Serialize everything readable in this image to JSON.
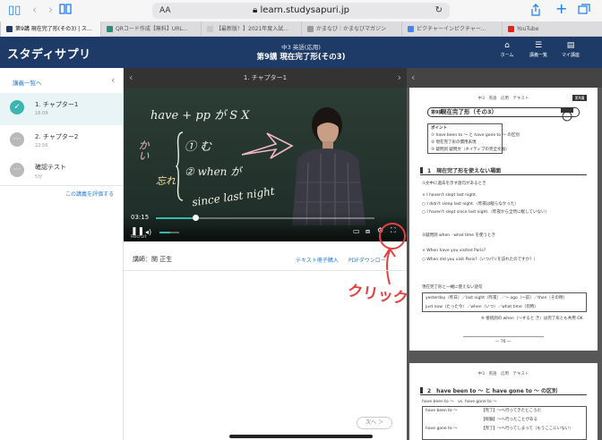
{
  "browser": {
    "url": "learn.studysapuri.jp",
    "aa": "AA",
    "tabs": [
      {
        "label": "第9講 現在完了形(その3) | ス...",
        "active": true,
        "color": "#1e3a66"
      },
      {
        "label": "QRコード作成【無料】URL...",
        "active": false,
        "color": "#2a8c7a"
      },
      {
        "label": "【最新版！】2021年度入試...",
        "active": false,
        "color": "#c8c8c8"
      },
      {
        "label": "かまなび｜かまなびマガジン",
        "active": false,
        "color": "#999999"
      },
      {
        "label": "ピクチャーインピクチャー...",
        "active": false,
        "color": "#4285f4"
      },
      {
        "label": "YouTube",
        "active": false,
        "color": "#e62117"
      }
    ]
  },
  "header": {
    "logo": "スタディサプリ",
    "subtitle": "中3 英語(応用)",
    "title": "第9講 現在完了形(その3)",
    "nav": [
      {
        "label": "ホーム",
        "icon": "home-icon"
      },
      {
        "label": "講義一覧",
        "icon": "list-icon"
      },
      {
        "label": "マイ講座",
        "icon": "my-course-icon"
      }
    ]
  },
  "sidebar": {
    "back": "講義一覧へ",
    "rate": "この講義を評価する",
    "chapters": [
      {
        "title": "1. チャプター1",
        "duration": "18:09",
        "state": "done"
      },
      {
        "title": "2. チャプター2",
        "duration": "22:56",
        "state": "pending"
      },
      {
        "title": "確認テスト",
        "duration": "5分",
        "state": "test"
      }
    ]
  },
  "video": {
    "chapter_title": "1. チャプター1",
    "time": "03:15",
    "progress": 0.18,
    "volume": 0.55,
    "watermark": "Recruit",
    "chalk": [
      "have + pp が S X",
      "① む",
      "② when が",
      "since last night",
      "かい",
      "忘れ"
    ]
  },
  "below": {
    "lecturer": "講師：関 正生",
    "buy_text": "テキスト冊子購入",
    "pdf_download": "PDFダウンロー",
    "next": "次へ ＞",
    "annotation": "クリック"
  },
  "pdf": {
    "page1": {
      "header": "中3　英語　応用　テキスト",
      "badge": "第9講",
      "lesson_num": "第9講",
      "title": "現在完了形（その3）",
      "point_label": "ポイント",
      "points": [
        "① have been to 〜 と have gone to 〜 の区別",
        "② 現在完了形の慣用表現",
        "③ 疑問詞 疑問文（ネイティブの完全文脈）"
      ],
      "section1": "1　現在完了形を使えない場面",
      "lines": [
        "①文中に過去を示す語句があるとき",
        "× I haven't slept last night.",
        "○ I didn't sleep last night.（昨夜は眠らなかった）",
        "○ I haven't slept since last night.（昨夜から全然に眠していない）",
        "②疑問詞 when · what time を使うとき",
        "× When have you visited Paris?",
        "○ When did you visit Paris?（いつパリを訪れたのですか？）",
        "現在完了形と一緒に使えない語句",
        "yesterday（昨日）／last night（昨夜）／〜 ago（〜前）／then（その時）",
        "just now（たった今）／when（いつ）／what time（何時）",
        "※ 接続詞の when（〜すると き）は完了形とも共用 OK"
      ],
      "footer": "— 76 —"
    },
    "page2": {
      "header": "中3　英語　応用　テキスト",
      "section2": "2　have been to 〜 と have gone to 〜 の区別",
      "lines": [
        "have been to 〜　vs. have gone to 〜",
        "have been to 〜",
        "【完了】〜へ行ってきたところだ",
        "【経験】〜へ行ったことがある",
        "have gone to 〜",
        "【完了】〜へ行ってしまって（もうここにいない）"
      ]
    }
  },
  "colors": {
    "navy": "#1e3a66",
    "accent_teal": "#3ab5b0",
    "link_blue": "#2e7ccf",
    "annotation_red": "#e34040"
  }
}
